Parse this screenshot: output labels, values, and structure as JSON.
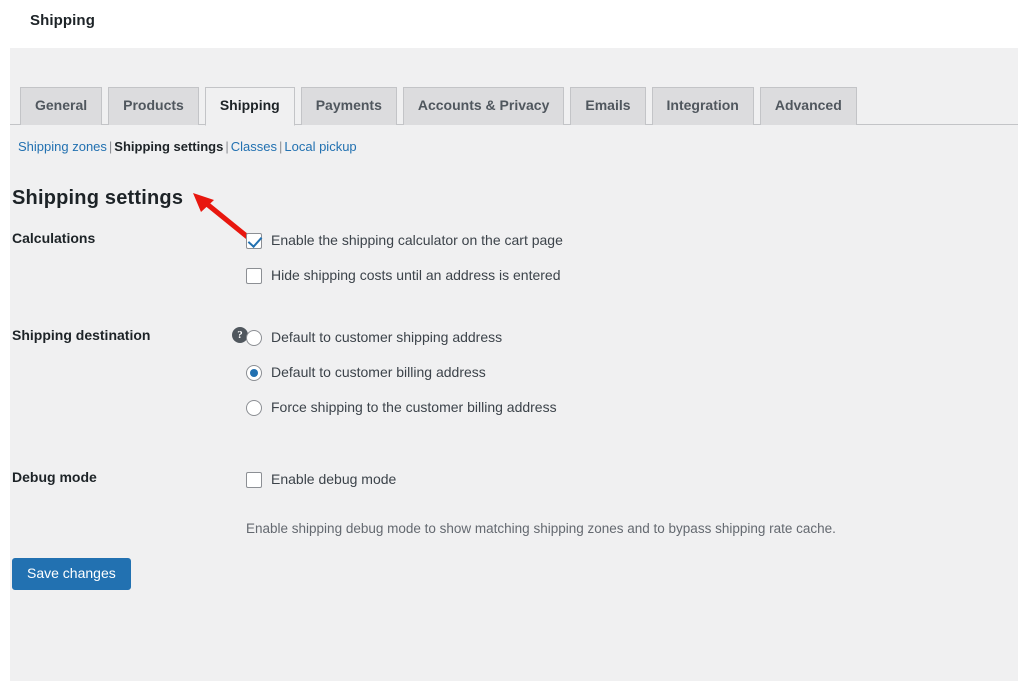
{
  "header": {
    "title": "Shipping"
  },
  "tabs": [
    {
      "label": "General",
      "active": false
    },
    {
      "label": "Products",
      "active": false
    },
    {
      "label": "Shipping",
      "active": true
    },
    {
      "label": "Payments",
      "active": false
    },
    {
      "label": "Accounts & Privacy",
      "active": false
    },
    {
      "label": "Emails",
      "active": false
    },
    {
      "label": "Integration",
      "active": false
    },
    {
      "label": "Advanced",
      "active": false
    }
  ],
  "subnav": {
    "separator": "|",
    "items": [
      {
        "label": "Shipping zones",
        "current": false
      },
      {
        "label": "Shipping settings",
        "current": true
      },
      {
        "label": "Classes",
        "current": false
      },
      {
        "label": "Local pickup",
        "current": false
      }
    ]
  },
  "page_heading": "Shipping settings",
  "sections": {
    "calculations": {
      "label": "Calculations",
      "options": [
        {
          "label": "Enable the shipping calculator on the cart page",
          "checked": true
        },
        {
          "label": "Hide shipping costs until an address is entered",
          "checked": false
        }
      ]
    },
    "shipping_destination": {
      "label": "Shipping destination",
      "help_icon": "help-question-icon",
      "help_glyph": "?",
      "options": [
        {
          "label": "Default to customer shipping address",
          "selected": false
        },
        {
          "label": "Default to customer billing address",
          "selected": true
        },
        {
          "label": "Force shipping to the customer billing address",
          "selected": false
        }
      ]
    },
    "debug_mode": {
      "label": "Debug mode",
      "option": {
        "label": "Enable debug mode",
        "checked": false
      },
      "description": "Enable shipping debug mode to show matching shipping zones and to bypass shipping rate cache."
    }
  },
  "submit": {
    "save_label": "Save changes"
  },
  "annotation": {
    "name": "red-arrow-pointing-to-shipping-settings-link",
    "color": "#e8170f"
  },
  "colors": {
    "accent": "#2271b1",
    "page_background": "#f0f0f1",
    "tab_inactive": "#dcdcde",
    "border": "#c3c4c7",
    "text": "#3c434a",
    "heading": "#1d2327",
    "muted": "#646970"
  }
}
